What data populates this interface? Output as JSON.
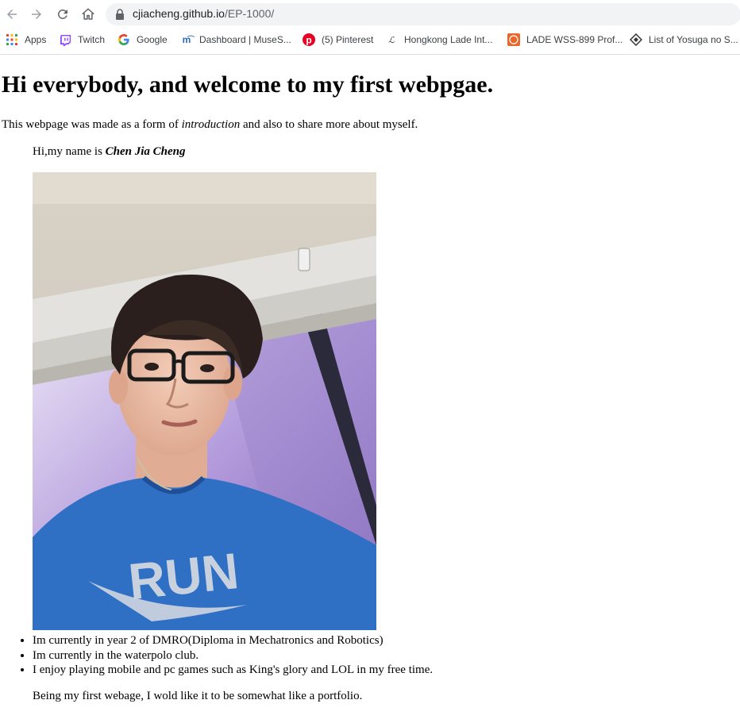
{
  "browser": {
    "url_host": "cjiacheng.github.io",
    "url_path": "/EP-1000/",
    "bookmarks": [
      {
        "label": "Apps",
        "icon": "apps-grid-icon"
      },
      {
        "label": "Twitch",
        "icon": "twitch-icon"
      },
      {
        "label": "Google",
        "icon": "google-icon"
      },
      {
        "label": "Dashboard | MuseS...",
        "icon": "musescore-icon"
      },
      {
        "label": "(5) Pinterest",
        "icon": "pinterest-icon"
      },
      {
        "label": "Hongkong Lade Int...",
        "icon": "lade-icon"
      },
      {
        "label": "LADE WSS-899 Prof...",
        "icon": "lade-orange-icon"
      },
      {
        "label": "List of Yosuga no S...",
        "icon": "heart-diamond-icon"
      }
    ]
  },
  "page": {
    "title": "Hi everybody, and welcome to my first webpgae.",
    "intro_before": "This webpage was made as a form of ",
    "intro_em": "introduction",
    "intro_after": " and also to share more about myself.",
    "name_prefix": "Hi,my name is ",
    "name": "Chen Jia Cheng",
    "photo_alt": "Photo of Chen Jia Cheng",
    "facts": [
      "Im currently in year 2 of DMRO(Diploma in Mechatronics and Robotics)",
      "Im currently in the waterpolo club.",
      "I enjoy playing mobile and pc games such as King's glory and LOL in my free time."
    ],
    "outro": "Being my first webage, I wold like it to be somewhat like a portfolio."
  },
  "colors": {
    "twitch": "#9146ff",
    "pinterest": "#e60023",
    "shirt_blue": "#2f6fc4"
  }
}
